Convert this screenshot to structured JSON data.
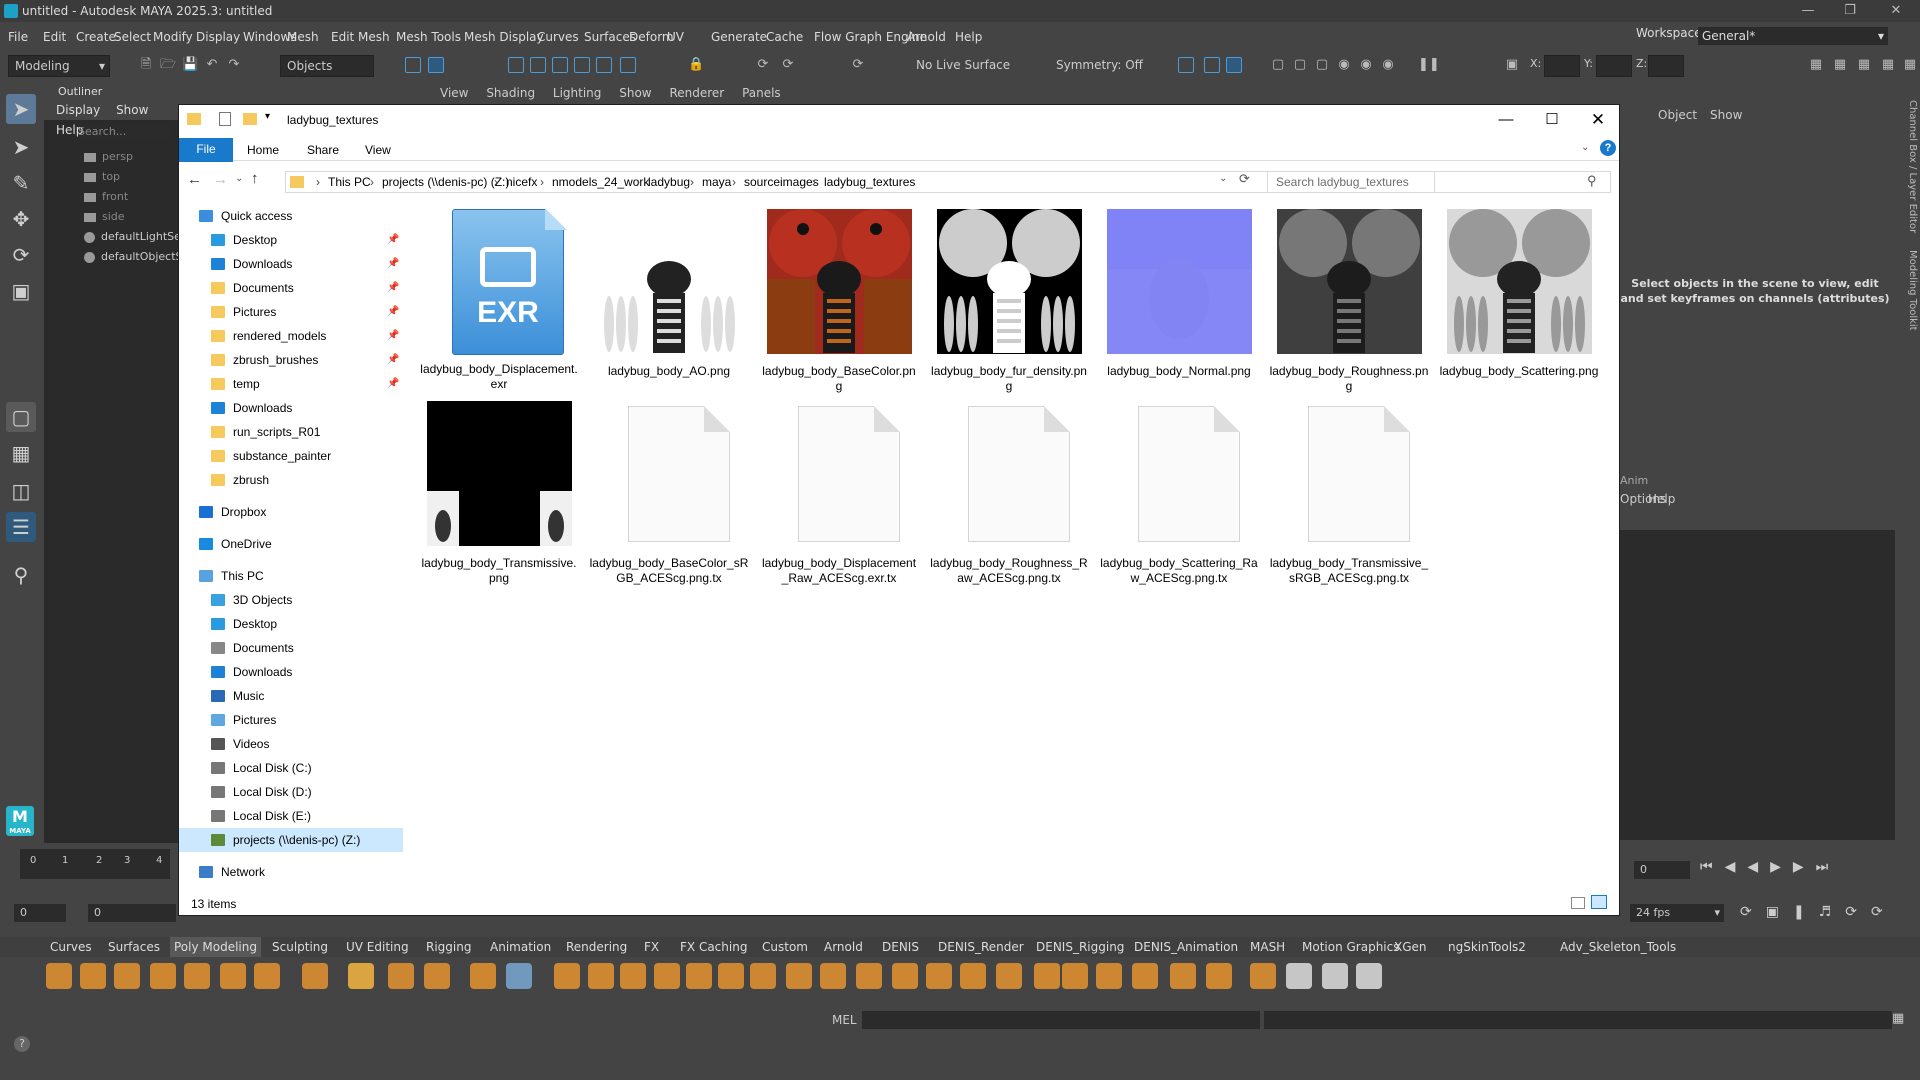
{
  "maya": {
    "title": "untitled - Autodesk MAYA 2025.3: untitled",
    "menu": [
      "File",
      "Edit",
      "Create",
      "Select",
      "Modify",
      "Display",
      "Windows",
      "Mesh",
      "Edit Mesh",
      "Mesh Tools",
      "Mesh Display",
      "Curves",
      "Surfaces",
      "Deform",
      "UV",
      "Generate",
      "Cache",
      "Flow Graph Engine",
      "Arnold",
      "Help"
    ],
    "workspace_label": "Workspace:",
    "workspace_value": "General*",
    "mode": "Modeling",
    "objects_field": "Objects",
    "live_surface": "No Live Surface",
    "symmetry": "Symmetry: Off",
    "xyz": [
      "X:",
      "Y:",
      "Z:"
    ],
    "outliner": {
      "title": "Outliner",
      "menu": [
        "Display",
        "Show",
        "Help"
      ],
      "search_placeholder": "Search...",
      "items": [
        "persp",
        "top",
        "front",
        "side",
        "defaultLightSet",
        "defaultObjectSet"
      ]
    },
    "viewport_menu": [
      "View",
      "Shading",
      "Lighting",
      "Show",
      "Renderer",
      "Panels"
    ],
    "channel_box": {
      "menu": [
        "Object",
        "Show"
      ],
      "message": "Select objects in the scene to view, edit and set keyframes on channels (attributes)",
      "vtabs": [
        "Channel Box / Layer Editor",
        "Modeling Toolkit"
      ]
    },
    "layer_menu": [
      "Anim",
      "Options",
      "Help"
    ],
    "timeline": {
      "ticks": [
        "0",
        "1",
        "2",
        "3",
        "4"
      ],
      "current_frame": "0",
      "range_start": "0",
      "range_start2": "0",
      "fps": "24 fps"
    },
    "shelf_tabs": [
      "Curves",
      "Surfaces",
      "Poly Modeling",
      "Sculpting",
      "UV Editing",
      "Rigging",
      "Animation",
      "Rendering",
      "FX",
      "FX Caching",
      "Custom",
      "Arnold",
      "DENIS",
      "DENIS_Render",
      "DENIS_Rigging",
      "DENIS_Animation",
      "MASH",
      "Motion Graphics",
      "XGen",
      "ngSkinTools2",
      "Adv_Skeleton_Tools"
    ],
    "active_shelf": "Poly Modeling",
    "cmd_label": "MEL",
    "logo_text": "M",
    "logo_sub": "MAYA"
  },
  "explorer": {
    "title": "ladybug_textures",
    "ribbon": [
      "File",
      "Home",
      "Share",
      "View"
    ],
    "breadcrumb": [
      "This PC",
      "projects (\\\\denis-pc) (Z:)",
      "nicefx",
      "nmodels_24_work",
      "ladybug",
      "maya",
      "sourceimages",
      "ladybug_textures"
    ],
    "search_placeholder": "Search ladybug_textures",
    "nav": {
      "quick_access": "Quick access",
      "pinned": [
        "Desktop",
        "Downloads",
        "Documents",
        "Pictures",
        "rendered_models",
        "zbrush_brushes",
        "temp"
      ],
      "recent": [
        "Downloads",
        "run_scripts_R01",
        "substance_painter",
        "zbrush"
      ],
      "dropbox": "Dropbox",
      "onedrive": "OneDrive",
      "this_pc": "This PC",
      "pc_items": [
        "3D Objects",
        "Desktop",
        "Documents",
        "Downloads",
        "Music",
        "Pictures",
        "Videos",
        "Local Disk (C:)",
        "Local Disk (D:)",
        "Local Disk (E:)",
        "projects (\\\\denis-pc) (Z:)"
      ],
      "network": "Network"
    },
    "files": [
      {
        "name": "ladybug_body_Displacement.exr",
        "kind": "exr",
        "badge": "EXR"
      },
      {
        "name": "ladybug_body_AO.png",
        "kind": "ao"
      },
      {
        "name": "ladybug_body_BaseColor.png",
        "kind": "basecolor"
      },
      {
        "name": "ladybug_body_fur_density.png",
        "kind": "fur"
      },
      {
        "name": "ladybug_body_Normal.png",
        "kind": "normal"
      },
      {
        "name": "ladybug_body_Roughness.png",
        "kind": "rough"
      },
      {
        "name": "ladybug_body_Scattering.png",
        "kind": "scatter"
      },
      {
        "name": "ladybug_body_Transmissive.png",
        "kind": "trans"
      },
      {
        "name": "ladybug_body_BaseColor_sRGB_ACEScg.png.tx",
        "kind": "doc"
      },
      {
        "name": "ladybug_body_Displacement_Raw_ACEScg.exr.tx",
        "kind": "doc"
      },
      {
        "name": "ladybug_body_Roughness_Raw_ACEScg.png.tx",
        "kind": "doc"
      },
      {
        "name": "ladybug_body_Scattering_Raw_ACEScg.png.tx",
        "kind": "doc"
      },
      {
        "name": "ladybug_body_Transmissive_sRGB_ACEScg.png.tx",
        "kind": "doc"
      }
    ],
    "status": "13 items",
    "colors": {
      "accent": "#1979ca",
      "selection": "#cce8ff",
      "folder": "#f5c95d"
    }
  }
}
